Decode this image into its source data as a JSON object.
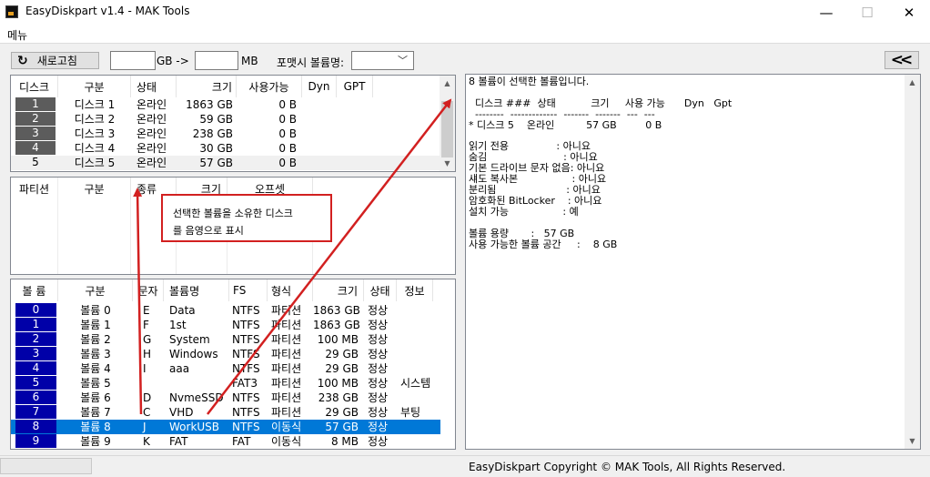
{
  "window": {
    "title": "EasyDiskpart v1.4 - MAK Tools",
    "minimize": "—",
    "maximize": "☐",
    "close": "✕"
  },
  "menu": {
    "label": "메뉴"
  },
  "toolbar": {
    "refresh_label": "새로고침",
    "refresh_icon": "refresh-icon",
    "gb_value": "",
    "gb_unit": "GB",
    "arrow": "->",
    "mb_value": "",
    "mb_unit": "MB",
    "volume_name_label": "포맷시 볼륨명:",
    "volume_name_value": "",
    "collapse_label": "<<"
  },
  "disks": {
    "columns": [
      "디스크",
      "구분",
      "상태",
      "크기",
      "사용가능",
      "Dyn",
      "GPT"
    ],
    "rows": [
      {
        "num": "1",
        "name": "디스크 1",
        "status": "온라인",
        "size": "1863 GB",
        "free": "0 B"
      },
      {
        "num": "2",
        "name": "디스크 2",
        "status": "온라인",
        "size": "59 GB",
        "free": "0 B"
      },
      {
        "num": "3",
        "name": "디스크 3",
        "status": "온라인",
        "size": "238 GB",
        "free": "0 B"
      },
      {
        "num": "4",
        "name": "디스크 4",
        "status": "온라인",
        "size": "30 GB",
        "free": "0 B"
      },
      {
        "num": "5",
        "name": "디스크 5",
        "status": "온라인",
        "size": "57 GB",
        "free": "0 B"
      }
    ]
  },
  "partitions": {
    "columns": [
      "파티션",
      "구분",
      "종류",
      "크기",
      "오프셋"
    ]
  },
  "volumes": {
    "columns": [
      "볼 륨",
      "구분",
      "문자",
      "볼륨명",
      "FS",
      "형식",
      "크기",
      "상태",
      "정보"
    ],
    "rows": [
      {
        "num": "0",
        "name": "볼륨 0",
        "letter": "E",
        "label": "Data",
        "fs": "NTFS",
        "type": "파티션",
        "size": "1863 GB",
        "status": "정상",
        "info": ""
      },
      {
        "num": "1",
        "name": "볼륨 1",
        "letter": "F",
        "label": "1st",
        "fs": "NTFS",
        "type": "파티션",
        "size": "1863 GB",
        "status": "정상",
        "info": ""
      },
      {
        "num": "2",
        "name": "볼륨 2",
        "letter": "G",
        "label": "System",
        "fs": "NTFS",
        "type": "파티션",
        "size": "100 MB",
        "status": "정상",
        "info": ""
      },
      {
        "num": "3",
        "name": "볼륨 3",
        "letter": "H",
        "label": "Windows",
        "fs": "NTFS",
        "type": "파티션",
        "size": "29 GB",
        "status": "정상",
        "info": ""
      },
      {
        "num": "4",
        "name": "볼륨 4",
        "letter": "I",
        "label": "aaa",
        "fs": "NTFS",
        "type": "파티션",
        "size": "29 GB",
        "status": "정상",
        "info": ""
      },
      {
        "num": "5",
        "name": "볼륨 5",
        "letter": "",
        "label": "",
        "fs": "FAT3",
        "type": "파티션",
        "size": "100 MB",
        "status": "정상",
        "info": "시스템"
      },
      {
        "num": "6",
        "name": "볼륨 6",
        "letter": "D",
        "label": "NvmeSSD",
        "fs": "NTFS",
        "type": "파티션",
        "size": "238 GB",
        "status": "정상",
        "info": ""
      },
      {
        "num": "7",
        "name": "볼륨 7",
        "letter": "C",
        "label": "VHD",
        "fs": "NTFS",
        "type": "파티션",
        "size": "29 GB",
        "status": "정상",
        "info": "부팅"
      },
      {
        "num": "8",
        "name": "볼륨 8",
        "letter": "J",
        "label": "WorkUSB",
        "fs": "NTFS",
        "type": "이동식",
        "size": "57 GB",
        "status": "정상",
        "info": ""
      },
      {
        "num": "9",
        "name": "볼륨 9",
        "letter": "K",
        "label": "FAT",
        "fs": "FAT",
        "type": "이동식",
        "size": "8 MB",
        "status": "정상",
        "info": ""
      }
    ]
  },
  "info": {
    "text": "8 볼륨이 선택한 볼륨입니다.\n\n  디스크 ###  상태           크기     사용 가능      Dyn   Gpt\n  --------  -------------  -------  -------  ---  ---\n* 디스크 5    온라인          57 GB         0 B\n\n읽기 전용               : 아니요\n숨김                        : 아니요\n기본 드라이브 문자 없음: 아니요\n섀도 복사본                 : 아니요\n분리됨                      : 아니요\n암호화된 BitLocker    : 아니요\n설치 가능                 : 예\n\n볼륨 용량       :   57 GB\n사용 가능한 볼륨 공간     :    8 GB"
  },
  "callout": {
    "line1": "선택한 볼륨을 소유한 디스크",
    "line2": "를 음영으로 표시"
  },
  "status": {
    "copyright": "EasyDiskpart Copyright © MAK Tools, All Rights Reserved."
  },
  "colors": {
    "selected_row": "#0078d7",
    "disk_index": "#5c5c5c",
    "volume_index": "#0000a8",
    "annotation": "#d22020"
  }
}
